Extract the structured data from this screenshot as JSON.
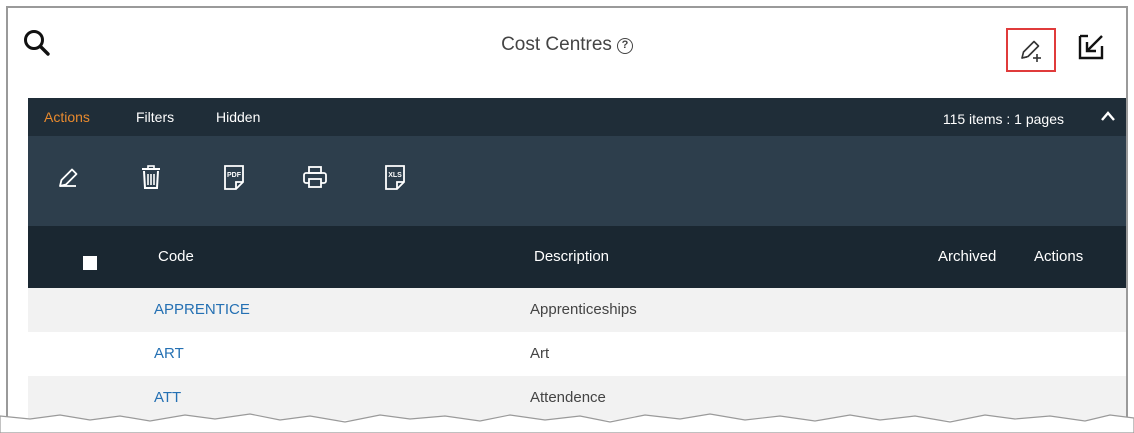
{
  "header": {
    "title": "Cost Centres",
    "help_glyph": "?",
    "search_icon": "search-icon",
    "add_icon": "pencil-plus-icon",
    "export_icon": "export-arrow-icon",
    "highlight_color": "#e03b3b"
  },
  "tabs": [
    {
      "label": "Actions",
      "active": true
    },
    {
      "label": "Filters",
      "active": false
    },
    {
      "label": "Hidden",
      "active": false
    }
  ],
  "pagination": {
    "summary": "115 items : 1 pages"
  },
  "toolbar": {
    "pdf_label": "PDF",
    "xls_label": "XLS"
  },
  "columns": {
    "code": "Code",
    "description": "Description",
    "archived": "Archived",
    "actions": "Actions"
  },
  "rows": [
    {
      "code": "APPRENTICE",
      "description": "Apprenticeships"
    },
    {
      "code": "ART",
      "description": "Art"
    },
    {
      "code": "ATT",
      "description": "Attendence"
    }
  ],
  "colors": {
    "tab_bar": "#1f2d38",
    "panel": "#2d3e4c",
    "column_header": "#1a2731",
    "active_tab": "#e88a2e",
    "link": "#2470b3"
  }
}
